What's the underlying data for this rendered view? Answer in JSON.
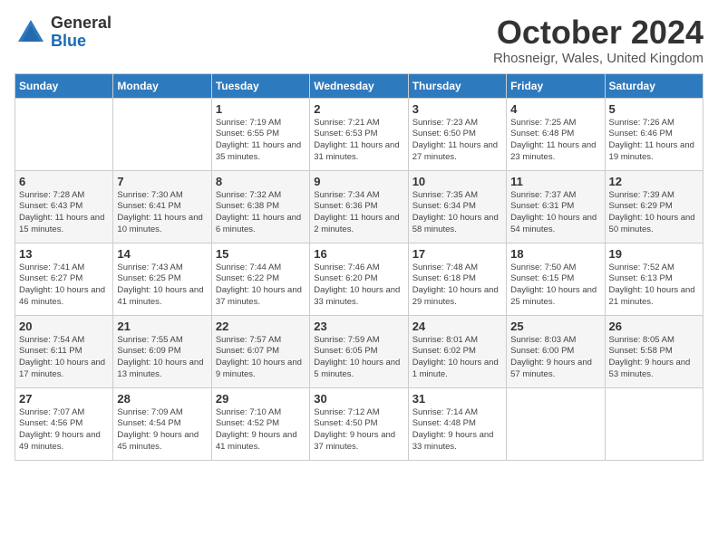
{
  "logo": {
    "general": "General",
    "blue": "Blue"
  },
  "header": {
    "month": "October 2024",
    "location": "Rhosneigr, Wales, United Kingdom"
  },
  "weekdays": [
    "Sunday",
    "Monday",
    "Tuesday",
    "Wednesday",
    "Thursday",
    "Friday",
    "Saturday"
  ],
  "weeks": [
    [
      {
        "day": "",
        "sunrise": "",
        "sunset": "",
        "daylight": ""
      },
      {
        "day": "",
        "sunrise": "",
        "sunset": "",
        "daylight": ""
      },
      {
        "day": "1",
        "sunrise": "Sunrise: 7:19 AM",
        "sunset": "Sunset: 6:55 PM",
        "daylight": "Daylight: 11 hours and 35 minutes."
      },
      {
        "day": "2",
        "sunrise": "Sunrise: 7:21 AM",
        "sunset": "Sunset: 6:53 PM",
        "daylight": "Daylight: 11 hours and 31 minutes."
      },
      {
        "day": "3",
        "sunrise": "Sunrise: 7:23 AM",
        "sunset": "Sunset: 6:50 PM",
        "daylight": "Daylight: 11 hours and 27 minutes."
      },
      {
        "day": "4",
        "sunrise": "Sunrise: 7:25 AM",
        "sunset": "Sunset: 6:48 PM",
        "daylight": "Daylight: 11 hours and 23 minutes."
      },
      {
        "day": "5",
        "sunrise": "Sunrise: 7:26 AM",
        "sunset": "Sunset: 6:46 PM",
        "daylight": "Daylight: 11 hours and 19 minutes."
      }
    ],
    [
      {
        "day": "6",
        "sunrise": "Sunrise: 7:28 AM",
        "sunset": "Sunset: 6:43 PM",
        "daylight": "Daylight: 11 hours and 15 minutes."
      },
      {
        "day": "7",
        "sunrise": "Sunrise: 7:30 AM",
        "sunset": "Sunset: 6:41 PM",
        "daylight": "Daylight: 11 hours and 10 minutes."
      },
      {
        "day": "8",
        "sunrise": "Sunrise: 7:32 AM",
        "sunset": "Sunset: 6:38 PM",
        "daylight": "Daylight: 11 hours and 6 minutes."
      },
      {
        "day": "9",
        "sunrise": "Sunrise: 7:34 AM",
        "sunset": "Sunset: 6:36 PM",
        "daylight": "Daylight: 11 hours and 2 minutes."
      },
      {
        "day": "10",
        "sunrise": "Sunrise: 7:35 AM",
        "sunset": "Sunset: 6:34 PM",
        "daylight": "Daylight: 10 hours and 58 minutes."
      },
      {
        "day": "11",
        "sunrise": "Sunrise: 7:37 AM",
        "sunset": "Sunset: 6:31 PM",
        "daylight": "Daylight: 10 hours and 54 minutes."
      },
      {
        "day": "12",
        "sunrise": "Sunrise: 7:39 AM",
        "sunset": "Sunset: 6:29 PM",
        "daylight": "Daylight: 10 hours and 50 minutes."
      }
    ],
    [
      {
        "day": "13",
        "sunrise": "Sunrise: 7:41 AM",
        "sunset": "Sunset: 6:27 PM",
        "daylight": "Daylight: 10 hours and 46 minutes."
      },
      {
        "day": "14",
        "sunrise": "Sunrise: 7:43 AM",
        "sunset": "Sunset: 6:25 PM",
        "daylight": "Daylight: 10 hours and 41 minutes."
      },
      {
        "day": "15",
        "sunrise": "Sunrise: 7:44 AM",
        "sunset": "Sunset: 6:22 PM",
        "daylight": "Daylight: 10 hours and 37 minutes."
      },
      {
        "day": "16",
        "sunrise": "Sunrise: 7:46 AM",
        "sunset": "Sunset: 6:20 PM",
        "daylight": "Daylight: 10 hours and 33 minutes."
      },
      {
        "day": "17",
        "sunrise": "Sunrise: 7:48 AM",
        "sunset": "Sunset: 6:18 PM",
        "daylight": "Daylight: 10 hours and 29 minutes."
      },
      {
        "day": "18",
        "sunrise": "Sunrise: 7:50 AM",
        "sunset": "Sunset: 6:15 PM",
        "daylight": "Daylight: 10 hours and 25 minutes."
      },
      {
        "day": "19",
        "sunrise": "Sunrise: 7:52 AM",
        "sunset": "Sunset: 6:13 PM",
        "daylight": "Daylight: 10 hours and 21 minutes."
      }
    ],
    [
      {
        "day": "20",
        "sunrise": "Sunrise: 7:54 AM",
        "sunset": "Sunset: 6:11 PM",
        "daylight": "Daylight: 10 hours and 17 minutes."
      },
      {
        "day": "21",
        "sunrise": "Sunrise: 7:55 AM",
        "sunset": "Sunset: 6:09 PM",
        "daylight": "Daylight: 10 hours and 13 minutes."
      },
      {
        "day": "22",
        "sunrise": "Sunrise: 7:57 AM",
        "sunset": "Sunset: 6:07 PM",
        "daylight": "Daylight: 10 hours and 9 minutes."
      },
      {
        "day": "23",
        "sunrise": "Sunrise: 7:59 AM",
        "sunset": "Sunset: 6:05 PM",
        "daylight": "Daylight: 10 hours and 5 minutes."
      },
      {
        "day": "24",
        "sunrise": "Sunrise: 8:01 AM",
        "sunset": "Sunset: 6:02 PM",
        "daylight": "Daylight: 10 hours and 1 minute."
      },
      {
        "day": "25",
        "sunrise": "Sunrise: 8:03 AM",
        "sunset": "Sunset: 6:00 PM",
        "daylight": "Daylight: 9 hours and 57 minutes."
      },
      {
        "day": "26",
        "sunrise": "Sunrise: 8:05 AM",
        "sunset": "Sunset: 5:58 PM",
        "daylight": "Daylight: 9 hours and 53 minutes."
      }
    ],
    [
      {
        "day": "27",
        "sunrise": "Sunrise: 7:07 AM",
        "sunset": "Sunset: 4:56 PM",
        "daylight": "Daylight: 9 hours and 49 minutes."
      },
      {
        "day": "28",
        "sunrise": "Sunrise: 7:09 AM",
        "sunset": "Sunset: 4:54 PM",
        "daylight": "Daylight: 9 hours and 45 minutes."
      },
      {
        "day": "29",
        "sunrise": "Sunrise: 7:10 AM",
        "sunset": "Sunset: 4:52 PM",
        "daylight": "Daylight: 9 hours and 41 minutes."
      },
      {
        "day": "30",
        "sunrise": "Sunrise: 7:12 AM",
        "sunset": "Sunset: 4:50 PM",
        "daylight": "Daylight: 9 hours and 37 minutes."
      },
      {
        "day": "31",
        "sunrise": "Sunrise: 7:14 AM",
        "sunset": "Sunset: 4:48 PM",
        "daylight": "Daylight: 9 hours and 33 minutes."
      },
      {
        "day": "",
        "sunrise": "",
        "sunset": "",
        "daylight": ""
      },
      {
        "day": "",
        "sunrise": "",
        "sunset": "",
        "daylight": ""
      }
    ]
  ]
}
